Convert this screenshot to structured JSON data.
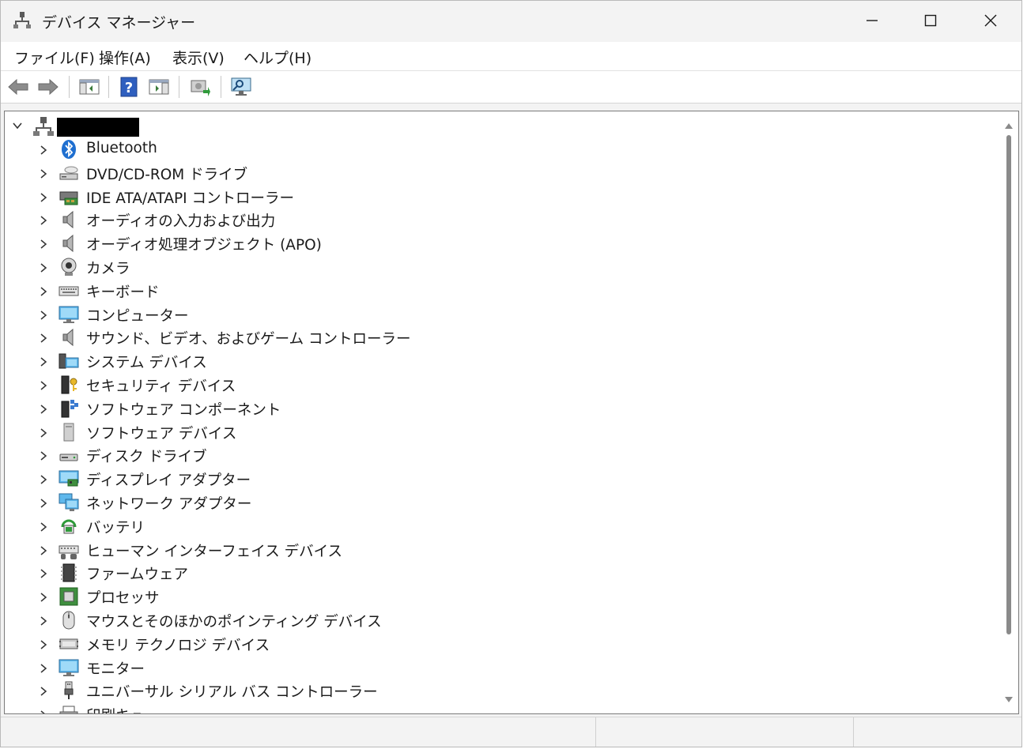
{
  "window": {
    "title": "デバイス マネージャー"
  },
  "menu": [
    {
      "label": "ファイル(F)"
    },
    {
      "label": "操作(A)"
    },
    {
      "label": "表示(V)"
    },
    {
      "label": "ヘルプ(H)"
    }
  ],
  "toolbar": {
    "buttons": [
      "back-icon",
      "forward-icon",
      "show-hide-console-tree-icon",
      "help-icon",
      "properties-icon",
      "update-driver-icon",
      "scan-hardware-icon"
    ]
  },
  "tree": {
    "root_name_redacted": true,
    "nodes": [
      {
        "label": "Bluetooth",
        "icon": "bluetooth-icon"
      },
      {
        "label": "DVD/CD-ROM ドライブ",
        "icon": "optical-drive-icon"
      },
      {
        "label": "IDE ATA/ATAPI コントローラー",
        "icon": "ide-controller-icon"
      },
      {
        "label": "オーディオの入力および出力",
        "icon": "speaker-icon"
      },
      {
        "label": "オーディオ処理オブジェクト (APO)",
        "icon": "speaker-icon"
      },
      {
        "label": "カメラ",
        "icon": "camera-icon"
      },
      {
        "label": "キーボード",
        "icon": "keyboard-icon"
      },
      {
        "label": "コンピューター",
        "icon": "computer-icon"
      },
      {
        "label": "サウンド、ビデオ、およびゲーム コントローラー",
        "icon": "speaker-icon"
      },
      {
        "label": "システム デバイス",
        "icon": "system-device-icon"
      },
      {
        "label": "セキュリティ デバイス",
        "icon": "security-device-icon"
      },
      {
        "label": "ソフトウェア コンポーネント",
        "icon": "software-component-icon"
      },
      {
        "label": "ソフトウェア デバイス",
        "icon": "software-device-icon"
      },
      {
        "label": "ディスク ドライブ",
        "icon": "disk-drive-icon"
      },
      {
        "label": "ディスプレイ アダプター",
        "icon": "display-adapter-icon"
      },
      {
        "label": "ネットワーク アダプター",
        "icon": "network-adapter-icon"
      },
      {
        "label": "バッテリ",
        "icon": "battery-icon"
      },
      {
        "label": "ヒューマン インターフェイス デバイス",
        "icon": "hid-icon"
      },
      {
        "label": "ファームウェア",
        "icon": "firmware-icon"
      },
      {
        "label": "プロセッサ",
        "icon": "processor-icon"
      },
      {
        "label": "マウスとそのほかのポインティング デバイス",
        "icon": "mouse-icon"
      },
      {
        "label": "メモリ テクノロジ デバイス",
        "icon": "memory-device-icon"
      },
      {
        "label": "モニター",
        "icon": "monitor-icon"
      },
      {
        "label": "ユニバーサル シリアル バス コントローラー",
        "icon": "usb-icon"
      },
      {
        "label": "印刷キュー",
        "icon": "printer-icon"
      }
    ]
  }
}
